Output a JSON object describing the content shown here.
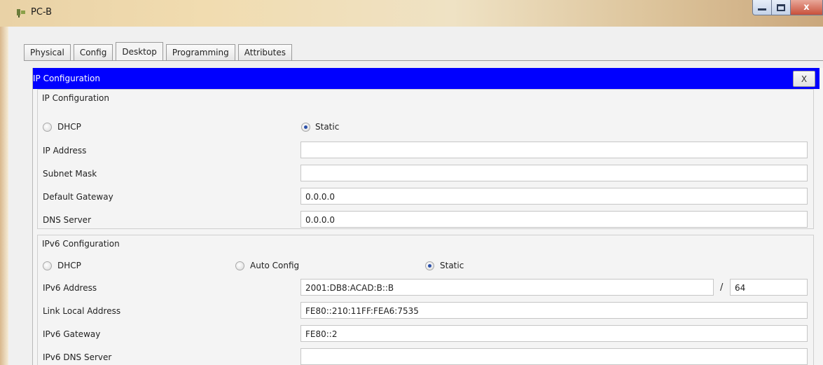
{
  "window": {
    "title": "PC-B",
    "icon": "network-device-icon",
    "controls": [
      "minimize-icon",
      "maximize-icon",
      "close-icon"
    ],
    "close_glyph": "x"
  },
  "tabs": [
    {
      "label": "Physical",
      "active": false
    },
    {
      "label": "Config",
      "active": false
    },
    {
      "label": "Desktop",
      "active": true
    },
    {
      "label": "Programming",
      "active": false
    },
    {
      "label": "Attributes",
      "active": false
    }
  ],
  "panel": {
    "title": "IP Configuration",
    "close_label": "X",
    "header_color": "#0000ff"
  },
  "ipv4": {
    "section_title": "IP Configuration",
    "dhcp_label": "DHCP",
    "static_label": "Static",
    "mode": "Static",
    "ip_address_label": "IP Address",
    "ip_address_value": "",
    "subnet_mask_label": "Subnet Mask",
    "subnet_mask_value": "",
    "default_gateway_label": "Default Gateway",
    "default_gateway_value": "0.0.0.0",
    "dns_server_label": "DNS Server",
    "dns_server_value": "0.0.0.0"
  },
  "ipv6": {
    "section_title": "IPv6 Configuration",
    "dhcp_label": "DHCP",
    "auto_config_label": "Auto Config",
    "static_label": "Static",
    "mode": "Static",
    "address_label": "IPv6 Address",
    "address_value": "2001:DB8:ACAD:B::B",
    "prefix_separator": "/",
    "prefix_value": "64",
    "link_local_label": "Link Local Address",
    "link_local_value": "FE80::210:11FF:FEA6:7535",
    "gateway_label": "IPv6 Gateway",
    "gateway_value": "FE80::2",
    "dns_server_label": "IPv6 DNS Server",
    "dns_server_value": ""
  }
}
